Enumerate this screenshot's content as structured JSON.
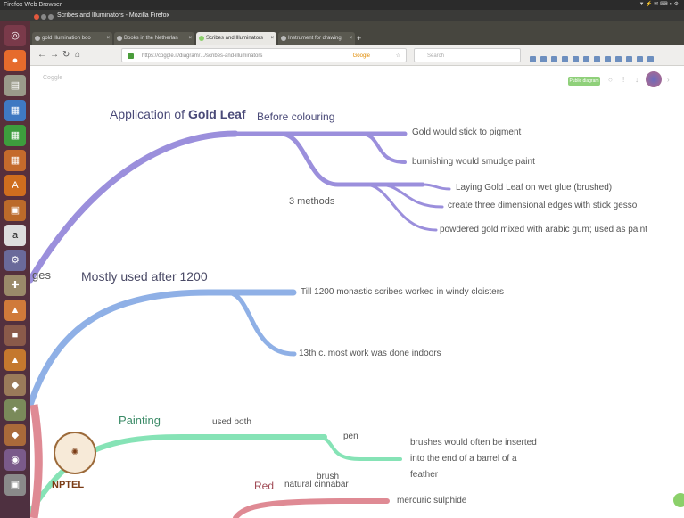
{
  "os": {
    "topbar_title": "Firefox Web Browser",
    "window_title": "Scribes and Illuminators - Mozilla Firefox"
  },
  "browser": {
    "tabs": [
      {
        "label": "gold illumination boo"
      },
      {
        "label": "Books in the Netherlan"
      },
      {
        "label": "Scribes and Illuminators"
      },
      {
        "label": "Instrument for drawing"
      }
    ],
    "url": "https://coggle.it/diagram/.../scribes-and-illuminators",
    "search_placeholder": "Search",
    "search_engine": "Google"
  },
  "page": {
    "logo": "Coggle",
    "badge": "Public diagram"
  },
  "mindmap": {
    "partial_root": "ges",
    "nodes": {
      "gold_leaf_prefix": "Application of ",
      "gold_leaf_bold": "Gold Leaf",
      "before_colouring": "Before colouring",
      "gold_stick": "Gold would stick to pigment",
      "burnishing": "burnishing would smudge paint",
      "three_methods": "3 methods",
      "laying": "Laying Gold Leaf on wet glue (brushed)",
      "create3d": "create three dimensional edges with stick gesso",
      "powdered": "powdered gold mixed with arabic gum; used as paint",
      "mostly_used": "Mostly used after 1200",
      "till1200": "Till 1200 monastic scribes worked in windy cloisters",
      "thirteenth": "13th c. most work was done indoors",
      "painting": "Painting",
      "used_both": "used both",
      "pen": "pen",
      "brushes_1": "brushes would often be inserted",
      "brushes_2": "into the end of a barrel of a",
      "brushes_3": "feather",
      "brush": "brush",
      "red": "Red",
      "natural_cinnabar": "natural cinnabar",
      "mercuric": "mercuric sulphide"
    },
    "colors": {
      "purple": "#9b8fdc",
      "blue": "#8fb0e6",
      "green": "#86e3b6",
      "red": "#df8a94"
    }
  },
  "watermark": {
    "label": "NPTEL"
  }
}
